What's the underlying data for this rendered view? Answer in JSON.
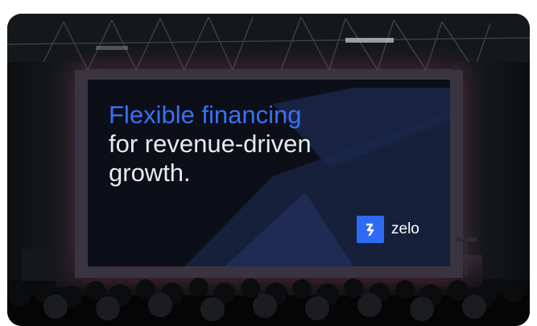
{
  "photo": {
    "subject": "projection-screen-in-auditorium",
    "colors": {
      "accent_blue": "#3b6ff5",
      "headline_white": "#e8eaee",
      "screen_bg": "#0c0f18",
      "stage_glow": "#be4678"
    }
  },
  "slide": {
    "headline_accent": "Flexible financing",
    "headline_line2": "for revenue-driven",
    "headline_line3": "growth.",
    "brand_icon": "zelo-logo-icon",
    "brand_name": "zelo"
  }
}
